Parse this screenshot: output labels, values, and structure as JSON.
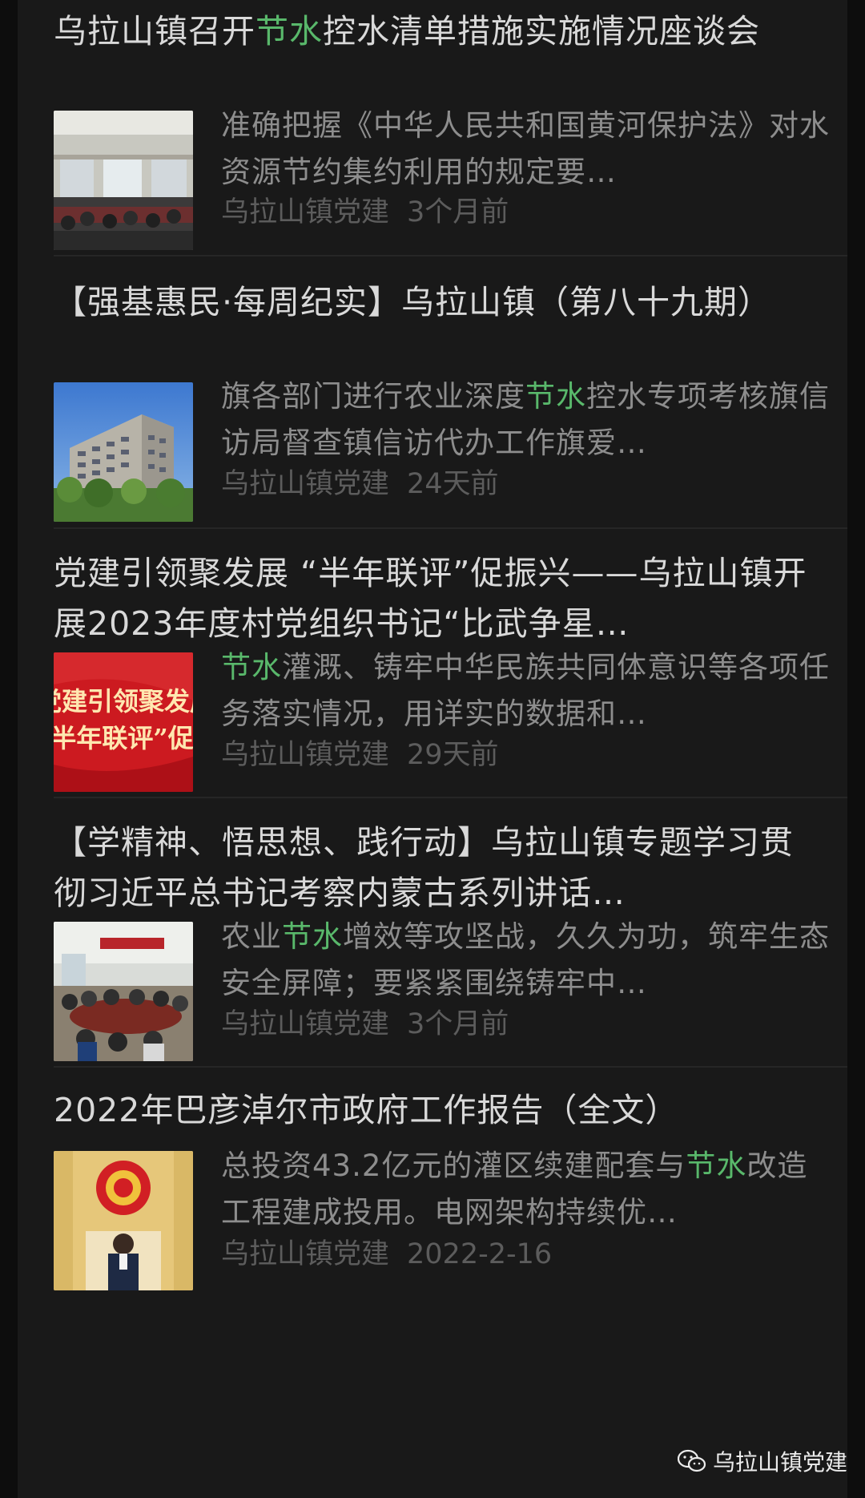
{
  "articles": [
    {
      "title_parts": [
        "乌拉山镇召开",
        "节水",
        "控水清单措施实施情况座谈会"
      ],
      "summary_parts": [
        "准确把握《中华人民共和国黄河保护法》对水资源节约集约利用的规定要",
        "",
        "…"
      ],
      "source": "乌拉山镇党建",
      "time": "3个月前"
    },
    {
      "title_parts": [
        "【强基惠民·每周纪实】乌拉山镇（第八十九期）",
        "",
        ""
      ],
      "summary_parts": [
        "旗各部门进行农业深度",
        "节水",
        "控水专项考核旗信访局督查镇信访代办工作旗爱…"
      ],
      "source": "乌拉山镇党建",
      "time": "24天前"
    },
    {
      "title_parts": [
        "党建引领聚发展 “半年联评”促振兴——乌拉山镇开展2023年度村党组织书记“比武争星…",
        "",
        ""
      ],
      "thumb_text": [
        "党建引领聚发展",
        "“半年联评”促"
      ],
      "summary_parts": [
        "",
        "节水",
        "灌溉、铸牢中华民族共同体意识等各项任务落实情况，用详实的数据和…"
      ],
      "source": "乌拉山镇党建",
      "time": "29天前"
    },
    {
      "title_parts": [
        "【学精神、悟思想、践行动】乌拉山镇专题学习贯彻习近平总书记考察内蒙古系列讲话…",
        "",
        ""
      ],
      "summary_parts": [
        "农业",
        "节水",
        "增效等攻坚战，久久为功，筑牢生态安全屏障；要紧紧围绕铸牢中…"
      ],
      "source": "乌拉山镇党建",
      "time": "3个月前"
    },
    {
      "title_parts": [
        "2022年巴彦淖尔市政府工作报告（全文）",
        "",
        ""
      ],
      "summary_parts": [
        "总投资43.2亿元的灌区续建配套与",
        "节水",
        "改造工程建成投用。电网架构持续优…"
      ],
      "source": "乌拉山镇党建",
      "time": "2022-2-16"
    }
  ],
  "watermark": {
    "text": "乌拉山镇党建",
    "icon": "wechat-icon"
  },
  "colors": {
    "background": "#191919",
    "title": "#d9d9d9",
    "summary": "#8d8d8d",
    "meta": "#5c5c5c",
    "highlight": "#59b86b"
  }
}
